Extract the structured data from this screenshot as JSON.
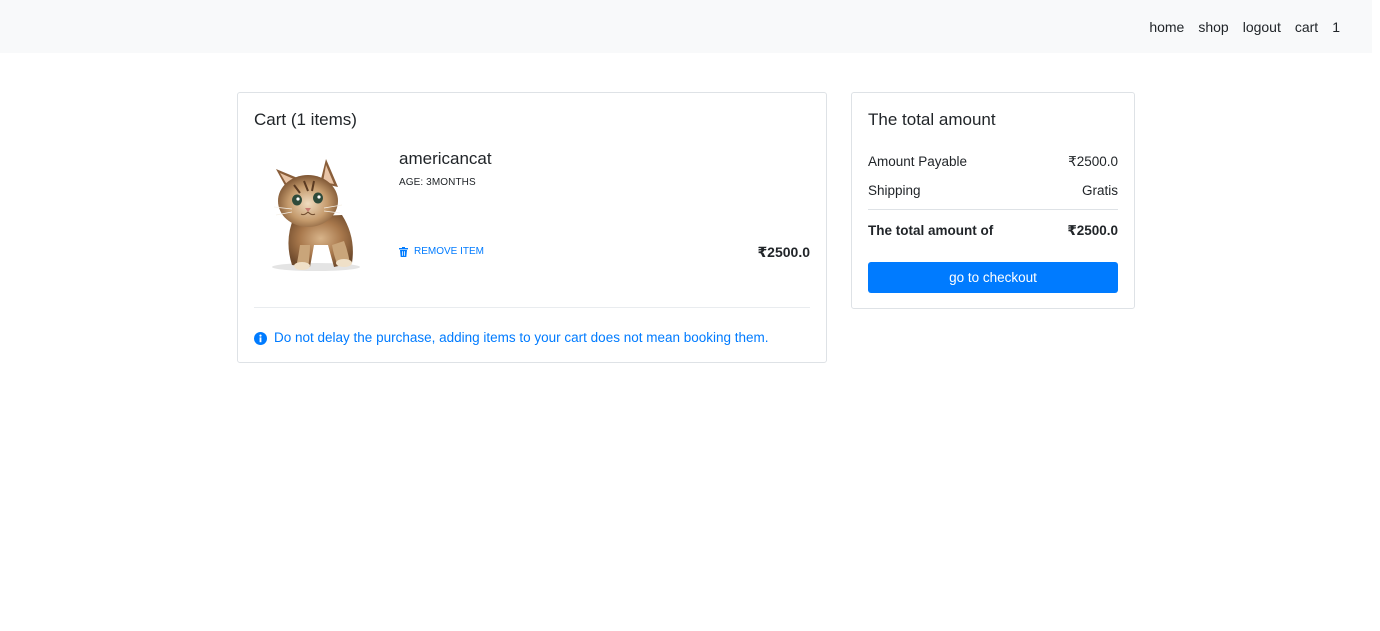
{
  "nav": {
    "links": [
      "home",
      "shop",
      "logout",
      "cart"
    ],
    "cart_count": "1"
  },
  "cart": {
    "title": "Cart (1 items)",
    "item": {
      "name": "americancat",
      "age": "AGE: 3MONTHS",
      "remove_label": "REMOVE ITEM",
      "price": "₹2500.0",
      "image_icon": "kitten-image"
    },
    "notice": "Do not delay the purchase, adding items to your cart does not mean booking them."
  },
  "summary": {
    "title": "The total amount",
    "amount_label": "Amount Payable",
    "amount_value": "₹2500.0",
    "shipping_label": "Shipping",
    "shipping_value": "Gratis",
    "total_label": "The total amount of",
    "total_value": "₹2500.0",
    "checkout_label": "go to checkout"
  },
  "colors": {
    "accent": "#007bff",
    "navbar_bg": "#f8f9fa",
    "border": "#dee2e6"
  }
}
